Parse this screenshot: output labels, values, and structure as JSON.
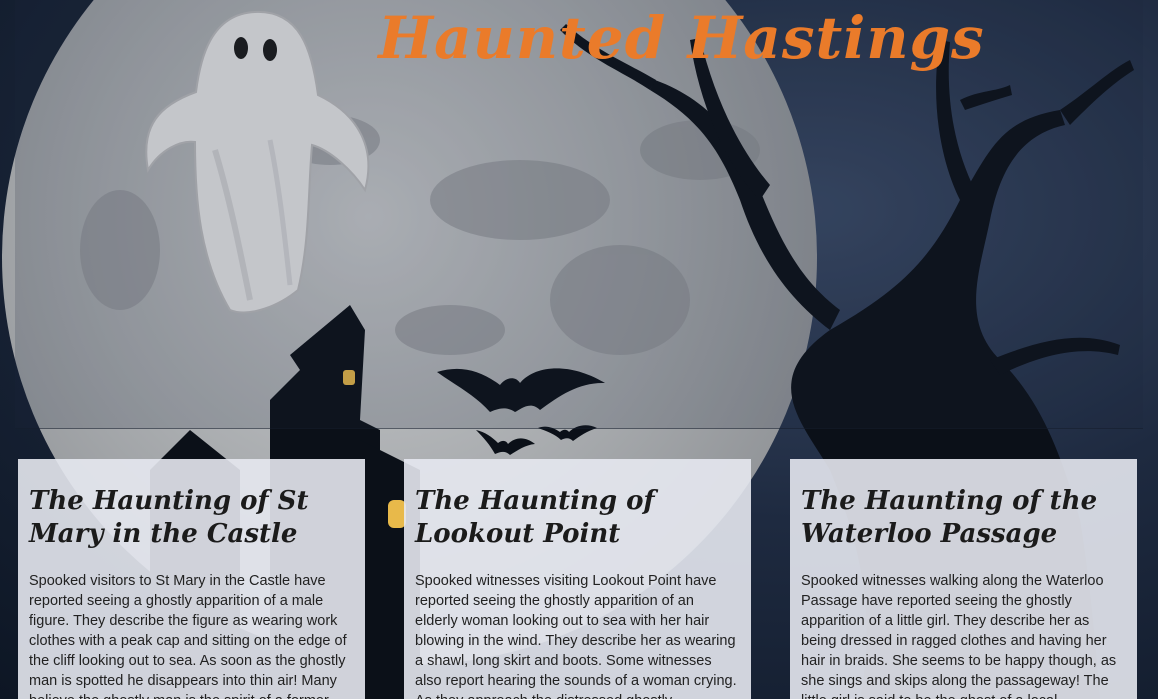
{
  "header": {
    "title": "Haunted Hastings"
  },
  "cards": [
    {
      "title": "The Haunting of St Mary in the Castle",
      "body": "Spooked visitors to St Mary in the Castle have reported seeing a ghostly apparition of a male figure. They describe the figure as wearing work clothes with a peak cap and sitting on the edge of the cliff looking out to sea. As soon as the ghostly man is spotted he disappears into thin air! Many believe the ghostly man is the spirit of a former"
    },
    {
      "title": "The Haunting of Lookout Point",
      "body": "Spooked witnesses visiting Lookout Point have reported seeing the ghostly apparition of an elderly woman looking out to sea with her hair blowing in the wind. They describe her as wearing a shawl, long skirt and boots. Some witnesses also report hearing the sounds of a woman crying. As they approach the distressed ghostly"
    },
    {
      "title": "The Haunting of the Waterloo Passage",
      "body": "Spooked witnesses walking along the Waterloo Passage have reported seeing the ghostly apparition of a little girl. They describe her as being dressed in ragged clothes and having her hair in braids. She seems to be happy though, as she sings and skips along the passageway! The little girl is said to be the ghost of a local"
    }
  ],
  "colors": {
    "title": "#ea7b2a",
    "card_bg": "#e6e8f0",
    "moon": "#a9acaf",
    "silhouette": "#0b1018"
  },
  "icons": [
    "ghost-illustration",
    "full-moon",
    "dead-tree",
    "haunted-house",
    "bats"
  ]
}
